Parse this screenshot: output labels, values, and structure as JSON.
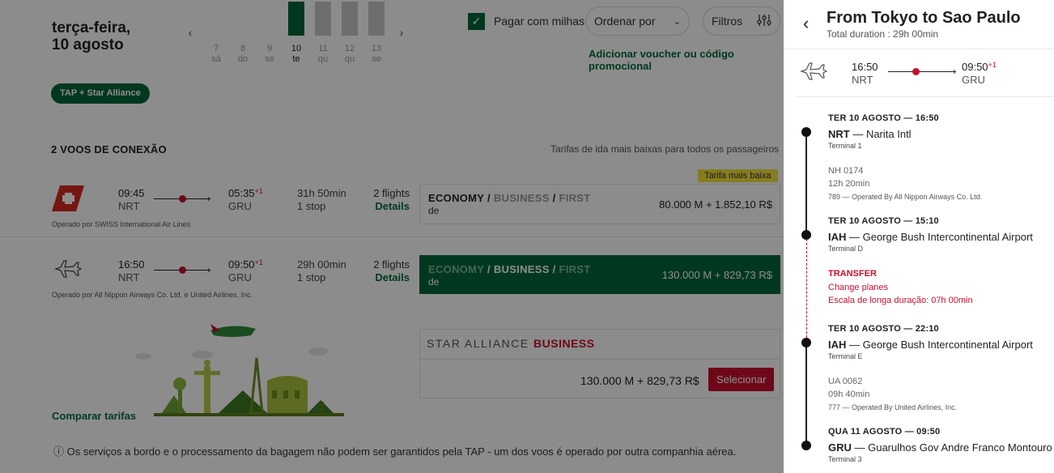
{
  "background_page": {
    "date_line1": "terça-feira,",
    "date_line2": "10 agosto",
    "day_strip": [
      {
        "num": "7",
        "abbr": "sá"
      },
      {
        "num": "8",
        "abbr": "do"
      },
      {
        "num": "9",
        "abbr": "se"
      },
      {
        "num": "10",
        "abbr": "te"
      },
      {
        "num": "11",
        "abbr": "qu"
      },
      {
        "num": "12",
        "abbr": "qu"
      },
      {
        "num": "13",
        "abbr": "se"
      }
    ],
    "pay_with_miles": "Pagar com milhas",
    "sort_by": "Ordenar por",
    "filters": "Filtros",
    "voucher_link": "Adicionar voucher ou código promocional",
    "alliance_badge": "TAP + Star Alliance",
    "section_title": "2 VOOS DE CONEXÃO",
    "section_sub": "Tarifas de ida mais baixas para todos os passageiros",
    "lowest_fare_badge": "Tarifa mais baixa",
    "flights": [
      {
        "dep_time": "09:45",
        "dep_code": "NRT",
        "arr_time": "05:35",
        "arr_plus": "+1",
        "arr_code": "GRU",
        "duration": "31h 50min",
        "stops": "1 stop",
        "count": "2 flights",
        "details": "Details",
        "operated": "Operado por SWISS International Air Lines",
        "cabin_economy": "ECONOMY",
        "cabin_business": "BUSINESS",
        "cabin_first": "FIRST",
        "slash": "/",
        "cabin_from": "de",
        "price": "80.000 M + 1.852,10 R$"
      },
      {
        "dep_time": "16:50",
        "dep_code": "NRT",
        "arr_time": "09:50",
        "arr_plus": "+1",
        "arr_code": "GRU",
        "duration": "29h 00min",
        "stops": "1 stop",
        "count": "2 flights",
        "details": "Details",
        "operated": "Operado por All Nippon Airways Co. Ltd. e United Airlines, Inc.",
        "cabin_economy": "ECONOMY",
        "cabin_business": "BUSINESS",
        "cabin_first": "FIRST",
        "slash": "/",
        "cabin_from": "de",
        "price": "130.000 M + 829,73 R$"
      }
    ],
    "alliance_offer": {
      "brand": "STAR ALLIANCE",
      "cabin": "BUSINESS",
      "price": "130.000 M + 829,73 R$",
      "select": "Selecionar"
    },
    "compare_fares": "Comparar tarifas",
    "info": "Os serviços a bordo e o processamento da bagagem não podem ser garantidos pela TAP - um dos voos é operado por outra companhia aérea.",
    "info_icon": "ⓘ"
  },
  "panel": {
    "title": "From Tokyo to Sao Paulo",
    "subtitle": "Total duration : 29h 00min",
    "summary": {
      "dep_time": "16:50",
      "dep_code": "NRT",
      "arr_time": "09:50",
      "arr_plus": "+1",
      "arr_code": "GRU"
    },
    "stops": [
      {
        "header": "TER 10 AGOSTO — 16:50",
        "code": "NRT",
        "name": " — Narita Intl",
        "terminal": "Terminal 1"
      },
      {
        "header": "TER 10 AGOSTO — 15:10",
        "code": "IAH",
        "name": " — George Bush Intercontinental Airport",
        "terminal": "Terminal D"
      },
      {
        "header": "TER 10 AGOSTO — 22:10",
        "code": "IAH",
        "name": " — George Bush Intercontinental Airport",
        "terminal": "Terminal E"
      },
      {
        "header": "QUA 11 AGOSTO — 09:50",
        "code": "GRU",
        "name": " — Guarulhos Gov Andre Franco Montouro",
        "terminal": "Terminal 3"
      }
    ],
    "legs": [
      {
        "flight": "NH 0174",
        "duration": "12h 20min",
        "operator": "789 — Operated By All Nippon Airways Co. Ltd."
      },
      {
        "flight": "UA 0062",
        "duration": "09h 40min",
        "operator": "777 — Operated By United Airlines, Inc."
      }
    ],
    "transfer": {
      "title": "TRANSFER",
      "line1": "Change planes",
      "line2": "Escala de longa duração: 07h 00min"
    }
  },
  "colors": {
    "tap_green": "#00663a",
    "accent_red": "#c8102e",
    "badge_yellow": "#f4e33a",
    "overlay": "rgba(0,0,0,0.45)"
  }
}
